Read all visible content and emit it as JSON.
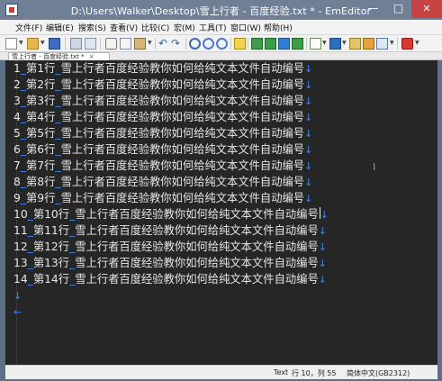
{
  "window": {
    "title": "D:\\Users\\Walker\\Desktop\\雪上行者 - 百度经验.txt * - EmEditor",
    "minimize_glyph": "—",
    "maximize_glyph": "□",
    "close_glyph": "✕"
  },
  "menubar": {
    "items": [
      "文件(F)",
      "编辑(E)",
      "搜索(S)",
      "查看(V)",
      "比较(C)",
      "宏(M)",
      "工具(T)",
      "窗口(W)",
      "帮助(H)"
    ]
  },
  "tab": {
    "label": "雪上行者 - 百度经验.txt *",
    "close_glyph": "×"
  },
  "editor": {
    "lines": [
      {
        "num": "1",
        "text": "第1行",
        "body": "雪上行者百度经验教你如何给纯文本文件自动编号"
      },
      {
        "num": "2",
        "text": "第2行",
        "body": "雪上行者百度经验教你如何给纯文本文件自动编号"
      },
      {
        "num": "3",
        "text": "第3行",
        "body": "雪上行者百度经验教你如何给纯文本文件自动编号"
      },
      {
        "num": "4",
        "text": "第4行",
        "body": "雪上行者百度经验教你如何给纯文本文件自动编号"
      },
      {
        "num": "5",
        "text": "第5行",
        "body": "雪上行者百度经验教你如何给纯文本文件自动编号"
      },
      {
        "num": "6",
        "text": "第6行",
        "body": "雪上行者百度经验教你如何给纯文本文件自动编号"
      },
      {
        "num": "7",
        "text": "第7行",
        "body": "雪上行者百度经验教你如何给纯文本文件自动编号"
      },
      {
        "num": "8",
        "text": "第8行",
        "body": "雪上行者百度经验教你如何给纯文本文件自动编号"
      },
      {
        "num": "9",
        "text": "第9行",
        "body": "雪上行者百度经验教你如何给纯文本文件自动编号"
      },
      {
        "num": "10",
        "text": "第10行",
        "body": "雪上行者百度经验教你如何给纯文本文件自动编号"
      },
      {
        "num": "11",
        "text": "第11行",
        "body": "雪上行者百度经验教你如何给纯文本文件自动编号"
      },
      {
        "num": "12",
        "text": "第12行",
        "body": "雪上行者百度经验教你如何给纯文本文件自动编号"
      },
      {
        "num": "13",
        "text": "第13行",
        "body": "雪上行者百度经验教你如何给纯文本文件自动编号"
      },
      {
        "num": "14",
        "text": "第14行",
        "body": "雪上行者百度经验教你如何给纯文本文件自动编号"
      }
    ],
    "newline_glyph": "↓",
    "eof_glyph": "←",
    "text_color": "#e6e6e6",
    "whitespace_mark_color": "#3d88ff",
    "background": "#262626"
  },
  "statusbar": {
    "mode": "Text",
    "position": "行 10，列 55",
    "encoding": "简体中文(GB2312)"
  },
  "icons": [
    "new-file-icon",
    "open-file-icon",
    "save-icon",
    "print-icon",
    "cut-icon",
    "copy-icon",
    "paste-icon",
    "undo-icon",
    "redo-icon",
    "find-icon",
    "find-next-icon",
    "find-prev-icon",
    "replace-icon",
    "highlight-icon",
    "ibeam-cursor-icon"
  ]
}
